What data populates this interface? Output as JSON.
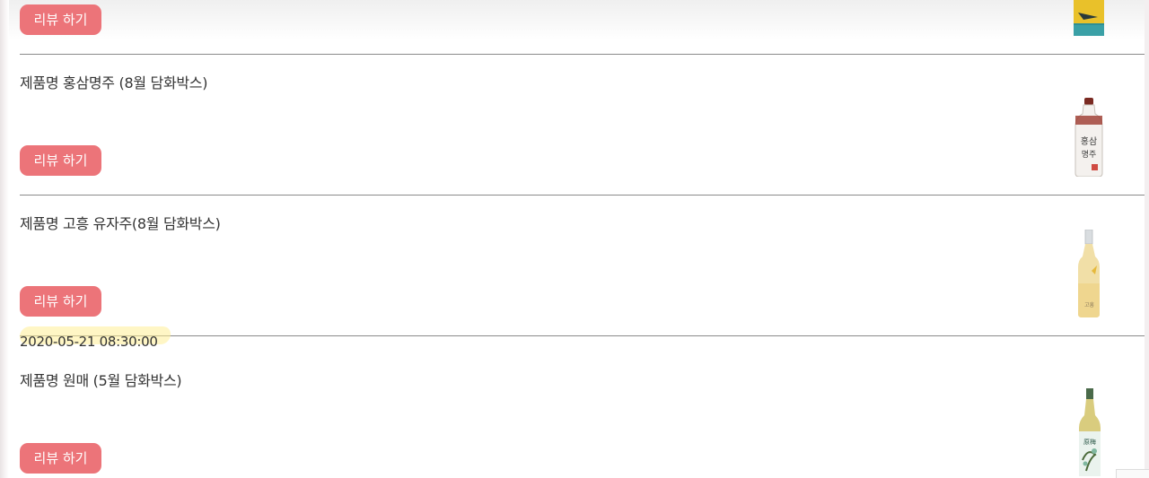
{
  "items": [
    {
      "name": "",
      "button_label": "리뷰 하기",
      "image": "teal-bottle-image"
    },
    {
      "name": "제품명 홍삼명주 (8월 담화박스)",
      "button_label": "리뷰 하기",
      "image": "red-ginseng-liquor-bottle-image"
    },
    {
      "name": "제품명 고흥 유자주(8월 담화박스)",
      "button_label": "리뷰 하기",
      "image": "yuja-liquor-bottle-image"
    },
    {
      "date": "2020-05-21 08:30:00",
      "name": "제품명 원매 (5월 담화박스)",
      "button_label": "리뷰 하기",
      "image": "plum-liquor-bottle-image"
    }
  ],
  "colors": {
    "button": "#ec7479",
    "highlight": "#fff096",
    "divider": "#8a8a8a"
  }
}
